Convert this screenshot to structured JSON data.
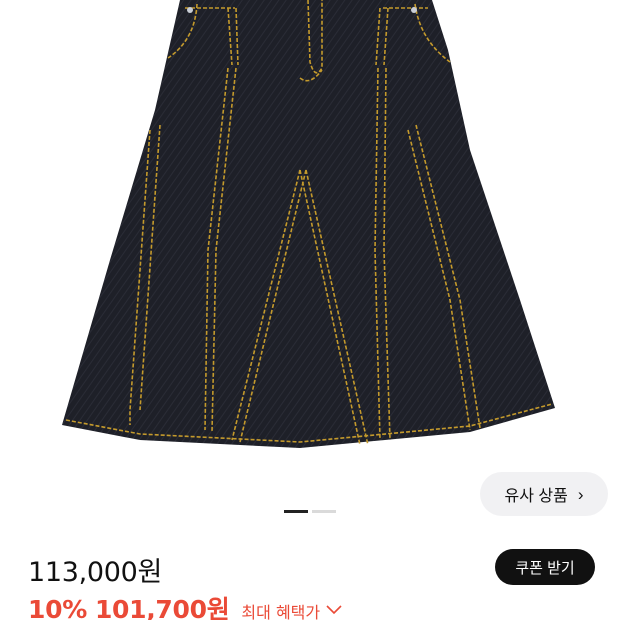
{
  "product": {
    "image": {
      "name": "dark denim A-line skirt"
    }
  },
  "similar_button": {
    "label": "유사 상품",
    "icon": "chevron-right-icon",
    "chevron": "›"
  },
  "image_indicator": {
    "count": 2,
    "active_index": 0
  },
  "price": {
    "original": "113,000원",
    "discount_rate": "10%",
    "sale": "101,700원",
    "benefit_label": "최대 혜택가",
    "benefit_icon": "chevron-down-icon",
    "benefit_chevron": "⌵"
  },
  "coupon_button": {
    "label": "쿠폰 받기"
  },
  "colors": {
    "accent": "#ea4a37",
    "denim": "#1f2129",
    "stitch": "#c49a2c"
  }
}
